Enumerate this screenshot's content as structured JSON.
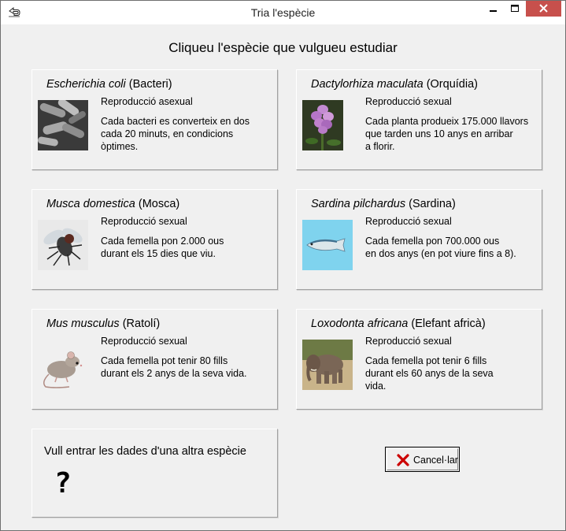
{
  "window": {
    "title": "Tria l'espècie"
  },
  "heading": "Cliqueu l'espècie que vulgueu estudiar",
  "species": [
    {
      "latin": "Escherichia coli",
      "common": "(Bacteri)",
      "reproduction": "Reproducció asexual",
      "desc": [
        "Cada bacteri es converteix en dos",
        "cada 20 minuts, en condicions",
        "òptimes."
      ]
    },
    {
      "latin": "Dactylorhiza maculata",
      "common": "(Orquídia)",
      "reproduction": "Reproducció sexual",
      "desc": [
        "Cada planta produeix 175.000 llavors",
        "que tarden uns 10 anys en arribar",
        "a florir."
      ]
    },
    {
      "latin": "Musca domestica",
      "common": "(Mosca)",
      "reproduction": "Reproducció sexual",
      "desc": [
        "Cada femella pon 2.000 ous",
        "durant els 15 dies que viu."
      ]
    },
    {
      "latin": "Sardina pilchardus",
      "common": "(Sardina)",
      "reproduction": "Reproducció sexual",
      "desc": [
        "Cada femella pon 700.000 ous",
        "en dos anys (en pot viure fins a 8)."
      ]
    },
    {
      "latin": "Mus musculus",
      "common": "(Ratolí)",
      "reproduction": "Reproducció sexual",
      "desc": [
        "Cada femella pot tenir 80 fills",
        "durant els 2 anys de la seva vida."
      ]
    },
    {
      "latin": "Loxodonta africana",
      "common": "(Elefant africà)",
      "reproduction": "Reproducció sexual",
      "desc": [
        "Cada femella pot tenir 6 fills",
        "durant els 60 anys de la seva",
        "vida."
      ]
    }
  ],
  "other": {
    "label": "Vull entrar les dades d'una altra espècie",
    "symbol": "?"
  },
  "cancel": {
    "label": "Cancel·lar"
  },
  "icons": {
    "app": "back-arrow-icon",
    "cancel": "red-x-icon"
  },
  "colors": {
    "close_button": "#c7504c",
    "cancel_x": "#cc0000"
  }
}
